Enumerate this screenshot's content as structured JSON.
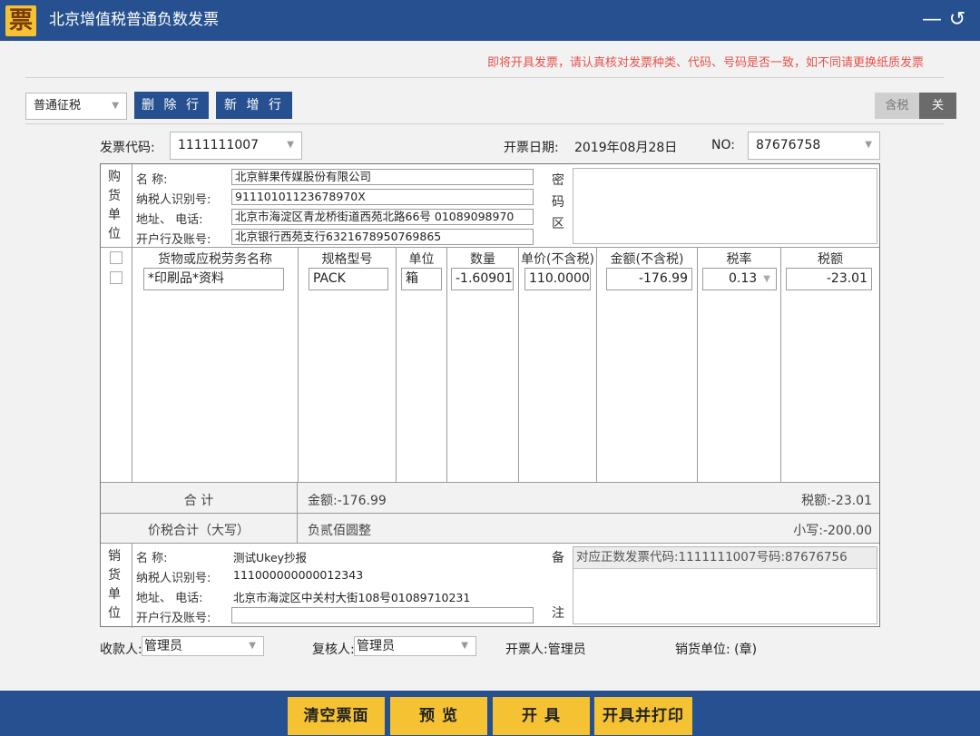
{
  "window": {
    "title": "北京增值税普通负数发票",
    "logo_char": "票",
    "minimize_symbol": "—",
    "back_symbol": "↺"
  },
  "notice": "即将开具发票，请认真核对发票种类、代码、号码是否一致，如不同请更换纸质发票",
  "toolbar": {
    "invoice_type": "普通征税",
    "delete_row": "删 除 行",
    "add_row": "新 增 行",
    "tax_incl_label": "含税",
    "tax_incl_state": "关"
  },
  "header": {
    "code_label": "发票代码:",
    "code_value": "1111111007",
    "date_label": "开票日期:",
    "date_value": "2019年08月28日",
    "no_label": "NO:",
    "no_value": "87676758"
  },
  "buyer": {
    "side_label": [
      "购",
      "货",
      "单",
      "位"
    ],
    "name_label": "名        称:",
    "name": "北京鲜果传媒股份有限公司",
    "taxid_label": "纳税人识别号:",
    "taxid": "91110101123678970X",
    "addr_label": "地址、  电话:",
    "addr": "北京市海淀区青龙桥街道西苑北路66号 01089098970",
    "bank_label": "开户行及账号:",
    "bank": "北京银行西苑支行6321678950769865"
  },
  "cipher_label": [
    "密",
    "码",
    "区"
  ],
  "columns": [
    "货物或应税劳务名称",
    "规格型号",
    "单位",
    "数量",
    "单价(不含税)",
    "金额(不含税)",
    "税率",
    "税额"
  ],
  "items": [
    {
      "name": "*印刷品*资料",
      "spec": "PACK",
      "unit": "箱",
      "qty": "-1.60901",
      "price": "110.0000",
      "amount": "-176.99",
      "rate": "0.13",
      "tax": "-23.01"
    }
  ],
  "totals": {
    "label": "合    计",
    "amount": "金额:-176.99",
    "tax": "税额:-23.01",
    "total_label": "价税合计（大写）",
    "total_words": "负贰佰圆整",
    "total_small": "小写:-200.00"
  },
  "seller": {
    "side_label": [
      "销",
      "货",
      "单",
      "位"
    ],
    "name_label": "名        称:",
    "name": "测试Ukey抄报",
    "taxid_label": "纳税人识别号:",
    "taxid": "111000000000012343",
    "addr_label": "地址、  电话:",
    "addr": "北京市海淀区中关村大街108号01089710231",
    "bank_label": "开户行及账号:",
    "bank": ""
  },
  "remark": {
    "label_top": "备",
    "label_bottom": "注",
    "text": "对应正数发票代码:1111111007号码:87676756"
  },
  "footer": {
    "payee_label": "收款人:",
    "payee": "管理员",
    "reviewer_label": "复核人:",
    "reviewer": "管理员",
    "drawer": "开票人:管理员",
    "seller_seal": "销货单位:  (章)"
  },
  "actions": {
    "clear": "清空票面",
    "preview": "预 览",
    "issue": "开 具",
    "issue_print": "开具并打印"
  }
}
